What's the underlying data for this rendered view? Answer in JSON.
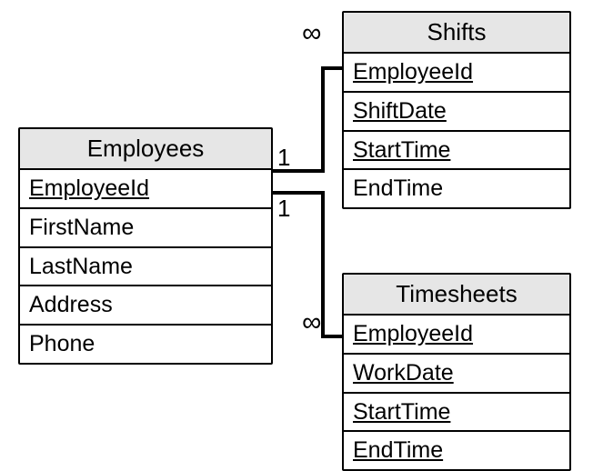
{
  "entities": {
    "employees": {
      "title": "Employees",
      "fields": [
        {
          "name": "EmployeeId",
          "pk": true
        },
        {
          "name": "FirstName",
          "pk": false
        },
        {
          "name": "LastName",
          "pk": false
        },
        {
          "name": "Address",
          "pk": false
        },
        {
          "name": "Phone",
          "pk": false
        }
      ]
    },
    "shifts": {
      "title": "Shifts",
      "fields": [
        {
          "name": "EmployeeId",
          "pk": true
        },
        {
          "name": "ShiftDate",
          "pk": true
        },
        {
          "name": "StartTime",
          "pk": true
        },
        {
          "name": "EndTime",
          "pk": false
        }
      ]
    },
    "timesheets": {
      "title": "Timesheets",
      "fields": [
        {
          "name": "EmployeeId",
          "pk": true
        },
        {
          "name": "WorkDate",
          "pk": true
        },
        {
          "name": "StartTime",
          "pk": true
        },
        {
          "name": "EndTime",
          "pk": true
        }
      ]
    }
  },
  "relationships": [
    {
      "from": "employees",
      "to": "shifts",
      "from_card": "1",
      "to_card": "∞"
    },
    {
      "from": "employees",
      "to": "timesheets",
      "from_card": "1",
      "to_card": "∞"
    }
  ],
  "labels": {
    "one_a": "1",
    "one_b": "1",
    "inf_a": "∞",
    "inf_b": "∞"
  },
  "chart_data": {
    "type": "er-diagram",
    "entities": [
      {
        "name": "Employees",
        "attributes": [
          "EmployeeId",
          "FirstName",
          "LastName",
          "Address",
          "Phone"
        ],
        "primary_key": [
          "EmployeeId"
        ]
      },
      {
        "name": "Shifts",
        "attributes": [
          "EmployeeId",
          "ShiftDate",
          "StartTime",
          "EndTime"
        ],
        "primary_key": [
          "EmployeeId",
          "ShiftDate",
          "StartTime"
        ]
      },
      {
        "name": "Timesheets",
        "attributes": [
          "EmployeeId",
          "WorkDate",
          "StartTime",
          "EndTime"
        ],
        "primary_key": [
          "EmployeeId",
          "WorkDate",
          "StartTime",
          "EndTime"
        ]
      }
    ],
    "relationships": [
      {
        "from": "Employees",
        "to": "Shifts",
        "cardinality": "1:many"
      },
      {
        "from": "Employees",
        "to": "Timesheets",
        "cardinality": "1:many"
      }
    ]
  }
}
